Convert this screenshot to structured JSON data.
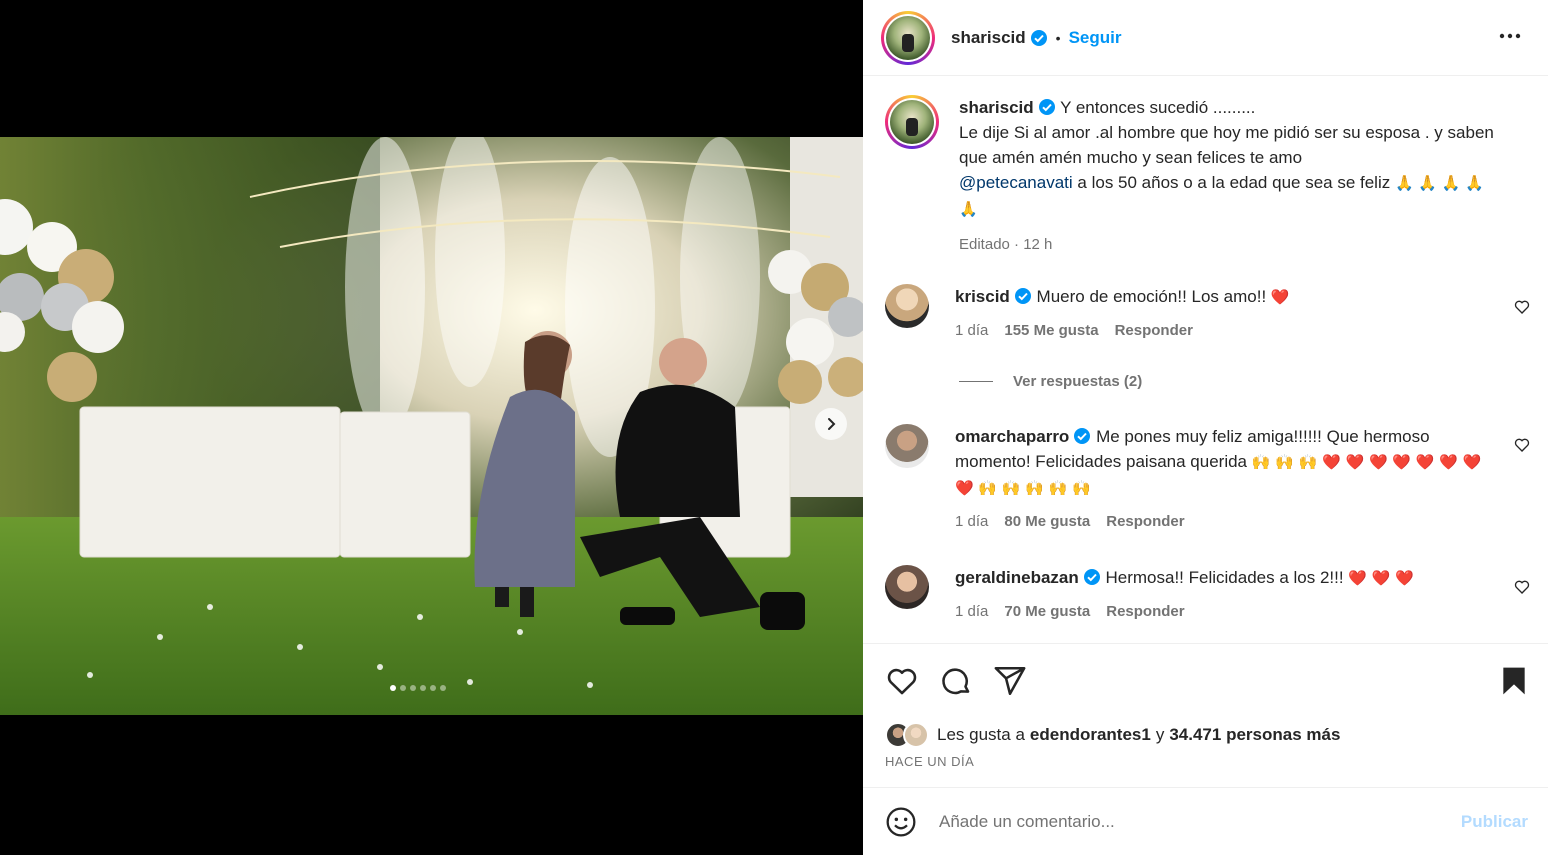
{
  "post": {
    "author": "shariscid",
    "separator": "•",
    "follow_label": "Seguir"
  },
  "caption": {
    "username": "shariscid",
    "line1": "Y entonces sucedió .........",
    "line2": "Le dije Si al amor .al hombre que hoy me pidió ser su esposa . y saben que amén amén mucho y sean felices te amo",
    "mention": "@petecanavati",
    "line3": "a los 50 años o a la edad que sea se feliz",
    "emoji_tail": "🙏 🙏 🙏 🙏 🙏",
    "meta": "Editado · 12 h"
  },
  "comments": [
    {
      "username": "kriscid",
      "text": "Muero de emoción!! Los amo!!",
      "emoji": "❤️",
      "time": "1 día",
      "likes": "155 Me gusta",
      "reply": "Responder",
      "avatar_color": "#c9a77d"
    },
    {
      "username": "omarchaparro",
      "text": "Me pones muy feliz amiga!!!!!! Que hermoso momento! Felicidades paisana querida",
      "emoji_hands": "🙌 🙌 🙌",
      "emoji_hearts": "❤️ ❤️ ❤️ ❤️ ❤️ ❤️ ❤️ ❤️",
      "emoji_hands2": "🙌 🙌 🙌 🙌 🙌",
      "time": "1 día",
      "likes": "80 Me gusta",
      "reply": "Responder",
      "avatar_color": "#8a7b6d"
    },
    {
      "username": "geraldinebazan",
      "text": "Hermosa!! Felicidades a los 2!!!",
      "emoji": "❤️ ❤️ ❤️",
      "time": "1 día",
      "likes": "70 Me gusta",
      "reply": "Responder",
      "avatar_color": "#6b5347"
    }
  ],
  "view_replies": "Ver respuestas (2)",
  "likes": {
    "prefix": "Les gusta a",
    "user": "edendorantes1",
    "joiner": "y",
    "others": "34.471 personas más"
  },
  "time_ago": "HACE UN DÍA",
  "comment_box": {
    "placeholder": "Añade un comentario...",
    "publish": "Publicar"
  },
  "colors": {
    "accent": "#0095f6",
    "verified": "#0095f6",
    "publish_disabled": "#b3dbff"
  },
  "carousel": {
    "slides": 6,
    "active": 1
  }
}
